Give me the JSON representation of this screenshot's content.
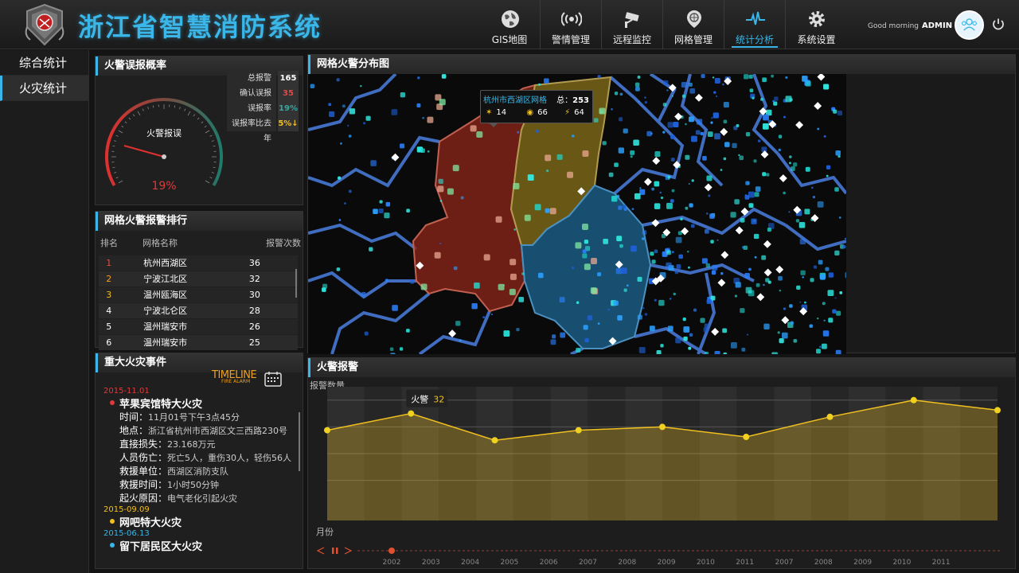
{
  "header": {
    "title": "浙江省智慧消防系统",
    "greeting": "Good morning",
    "user": "ADMIN"
  },
  "nav": [
    {
      "label": "GIS地图",
      "icon": "globe-icon"
    },
    {
      "label": "警情管理",
      "icon": "alarm-signal-icon"
    },
    {
      "label": "远程监控",
      "icon": "camera-icon"
    },
    {
      "label": "网格管理",
      "icon": "map-pin-icon"
    },
    {
      "label": "统计分析",
      "icon": "pulse-icon",
      "active": true
    },
    {
      "label": "系统设置",
      "icon": "gear-icon"
    }
  ],
  "sidemenu": [
    {
      "label": "综合统计"
    },
    {
      "label": "火灾统计",
      "active": true
    }
  ],
  "gauge": {
    "title": "火警误报概率",
    "center_label": "火警报误",
    "value_text": "19%",
    "value": 19,
    "stats": [
      {
        "k": "总报警",
        "v": "165",
        "color": "#ffffff"
      },
      {
        "k": "确认误报",
        "v": "35",
        "color": "#e04848"
      },
      {
        "k": "误报率",
        "v": "19%",
        "color": "#3aa5a0"
      },
      {
        "k": "误报率比去年",
        "v": "5%↓",
        "color": "#f0c020"
      }
    ]
  },
  "ranking": {
    "title": "网格火警报警排行",
    "headers": {
      "rank": "排名",
      "name": "网格名称",
      "count": "报警次数"
    },
    "rows": [
      {
        "rank": "1",
        "name": "杭州西湖区",
        "count": "36",
        "rank_color": "#e05040"
      },
      {
        "rank": "2",
        "name": "宁波江北区",
        "count": "32",
        "rank_color": "#f0a020"
      },
      {
        "rank": "3",
        "name": "温州瓯海区",
        "count": "30",
        "rank_color": "#f0c020"
      },
      {
        "rank": "4",
        "name": "宁波北仑区",
        "count": "28",
        "rank_color": "#ffffff"
      },
      {
        "rank": "5",
        "name": "温州瑞安市",
        "count": "26",
        "rank_color": "#ffffff"
      },
      {
        "rank": "6",
        "name": "温州瑞安市",
        "count": "25",
        "rank_color": "#ffffff"
      }
    ]
  },
  "events": {
    "title": "重大火灾事件",
    "timeline_label": "TIMELINE",
    "timeline_sub": "FIRE ALARM",
    "items": [
      {
        "date": "2015-11.01",
        "date_color": "#e03a3a",
        "dot": "#e03a3a",
        "title": "苹果宾馆特大火灾",
        "details": [
          {
            "lab": "时间：",
            "val": "11月01号下午3点45分"
          },
          {
            "lab": "地点：",
            "val": "浙江省杭州市西湖区文三西路230号"
          },
          {
            "lab": "直接损失：",
            "val": "23.168万元"
          },
          {
            "lab": "人员伤亡：",
            "val": "死亡5人，重伤30人，轻伤56人"
          },
          {
            "lab": "救援单位：",
            "val": "西湖区消防支队"
          },
          {
            "lab": "救援时间：",
            "val": "1小时50分钟"
          },
          {
            "lab": "起火原因：",
            "val": "电气老化引起火灾"
          }
        ]
      },
      {
        "date": "2015-09.09",
        "date_color": "#f0c020",
        "dot": "#f0c020",
        "title": "网吧特大火灾",
        "details": []
      },
      {
        "date": "2015-06.13",
        "date_color": "#3ab6e8",
        "dot": "#3ab6e8",
        "title": "留下居民区大火灾",
        "details": []
      }
    ]
  },
  "map": {
    "title": "网格火警分布图",
    "tooltip": {
      "name": "杭州市西湖区网格",
      "total_label": "总：",
      "total": "253",
      "fire": "14",
      "smoke": "66",
      "alarm": "64"
    }
  },
  "chart_data": {
    "type": "area",
    "title": "火警报警",
    "ylabel": "报警数量",
    "xlabel": "月份",
    "series": [
      {
        "name": "火警",
        "values": [
          27,
          32,
          24,
          27,
          28,
          25,
          31,
          36,
          33
        ]
      }
    ],
    "ylim": [
      0,
      40
    ],
    "highlight": {
      "index": 1,
      "label": "火警",
      "value": "32"
    },
    "timeline_years": [
      "2002",
      "2003",
      "2004",
      "2005",
      "2006",
      "2007",
      "2008",
      "2009",
      "2010",
      "2011",
      "2007",
      "2008",
      "2009",
      "2010",
      "2011"
    ],
    "grid": true
  },
  "colors": {
    "accent": "#3ab6e8",
    "line": "#f0c020",
    "red": "#e03a3a"
  }
}
